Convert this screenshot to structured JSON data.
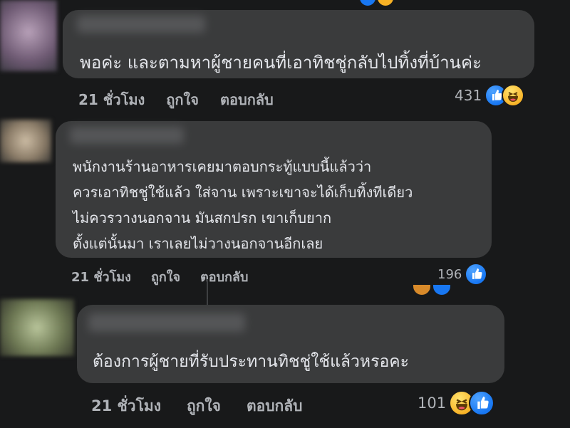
{
  "comments": [
    {
      "text_lines": [
        "พอค่ะ และตามหาผู้ชายคนที่เอาทิชชู่กลับไปทิ้งที่บ้านค่ะ"
      ],
      "time": "21 ชั่วโมง",
      "like_label": "ถูกใจ",
      "reply_label": "ตอบกลับ",
      "reaction_count": "431",
      "reactions": [
        "like-icon",
        "haha-icon"
      ]
    },
    {
      "text_lines": [
        "พนักงานร้านอาหารเคยมาตอบกระทู้แบบนี้แล้วว่า",
        "ควรเอาทิชชู่ใช้แล้ว ใส่จาน เพราะเขาจะได้เก็บทิ้งทีเดียว",
        "ไม่ควรวางนอกจาน มันสกปรก เขาเก็บยาก",
        "ตั้งแต่นั้นมา เราเลยไม่วางนอกจานอีกเลย"
      ],
      "time": "21 ชั่วโมง",
      "like_label": "ถูกใจ",
      "reply_label": "ตอบกลับ",
      "reaction_count": "196",
      "reactions": [
        "like-icon"
      ]
    },
    {
      "text_lines": [
        "ต้องการผู้ชายที่รับประทานทิชชู่ใช้แล้วหรอคะ"
      ],
      "time": "21 ชั่วโมง",
      "like_label": "ถูกใจ",
      "reply_label": "ตอบกลับ",
      "reaction_count": "101",
      "reactions": [
        "haha-icon",
        "like-icon"
      ]
    }
  ],
  "colors": {
    "background": "#18191a",
    "bubble": "#3a3b3c",
    "text": "#e4e6eb",
    "meta": "#b0b3b8",
    "like": "#1877f2",
    "haha": "#f7b125"
  }
}
